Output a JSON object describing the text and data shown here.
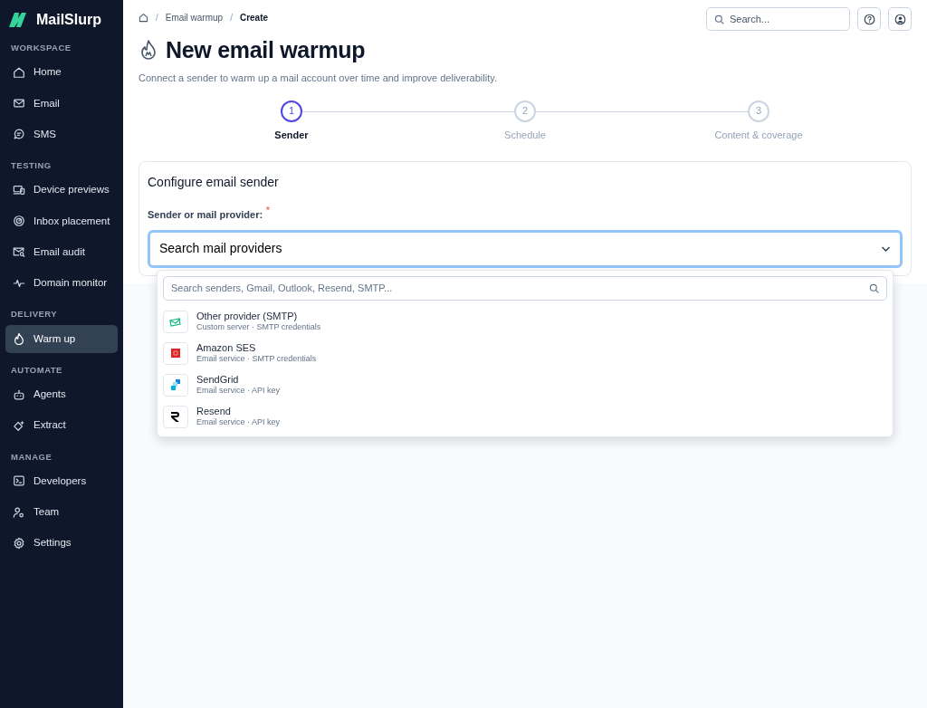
{
  "brand": "MailSlurp",
  "sidebar": {
    "sections": [
      {
        "heading": "WORKSPACE",
        "items": [
          {
            "label": "Home",
            "selected": false
          },
          {
            "label": "Email",
            "selected": false
          },
          {
            "label": "SMS",
            "selected": false
          }
        ]
      },
      {
        "heading": "TESTING",
        "items": [
          {
            "label": "Device previews",
            "selected": false
          },
          {
            "label": "Inbox placement",
            "selected": false
          },
          {
            "label": "Email audit",
            "selected": false
          },
          {
            "label": "Domain monitor",
            "selected": false
          }
        ]
      },
      {
        "heading": "DELIVERY",
        "items": [
          {
            "label": "Warm up",
            "selected": true
          }
        ]
      },
      {
        "heading": "AUTOMATE",
        "items": [
          {
            "label": "Agents",
            "selected": false
          },
          {
            "label": "Extract",
            "selected": false
          }
        ]
      },
      {
        "heading": "MANAGE",
        "items": [
          {
            "label": "Developers",
            "selected": false
          },
          {
            "label": "Team",
            "selected": false
          },
          {
            "label": "Settings",
            "selected": false
          }
        ]
      }
    ]
  },
  "breadcrumb": [
    {
      "separator": "/",
      "label": "Email warmup",
      "current": false
    },
    {
      "separator": "/",
      "label": "Create",
      "current": true
    }
  ],
  "top_search": {
    "placeholder": "Search..."
  },
  "title": "New email warmup",
  "subtitle": "Connect a sender to warm up a mail account over time and improve deliverability.",
  "steps": [
    {
      "number": "1",
      "label": "Sender",
      "selected": true
    },
    {
      "number": "2",
      "label": "Schedule",
      "selected": false
    },
    {
      "number": "3",
      "label": "Content & coverage",
      "selected": false
    }
  ],
  "card": {
    "title": "Configure email sender",
    "field_label": "Sender or mail provider:",
    "required_mark": "*",
    "select": {
      "placeholder": "Search mail providers",
      "expanded": true
    }
  },
  "dropdown": {
    "search": {
      "placeholder": "Search senders, Gmail, Outlook, Resend, SMTP..."
    },
    "options": [
      {
        "name": "Other provider (SMTP)",
        "detail": "Custom server · SMTP credentials"
      },
      {
        "name": "Amazon SES",
        "detail": "Email service · SMTP credentials"
      },
      {
        "name": "SendGrid",
        "detail": "Email service · API key"
      },
      {
        "name": "Resend",
        "detail": "Email service · API key"
      }
    ]
  }
}
